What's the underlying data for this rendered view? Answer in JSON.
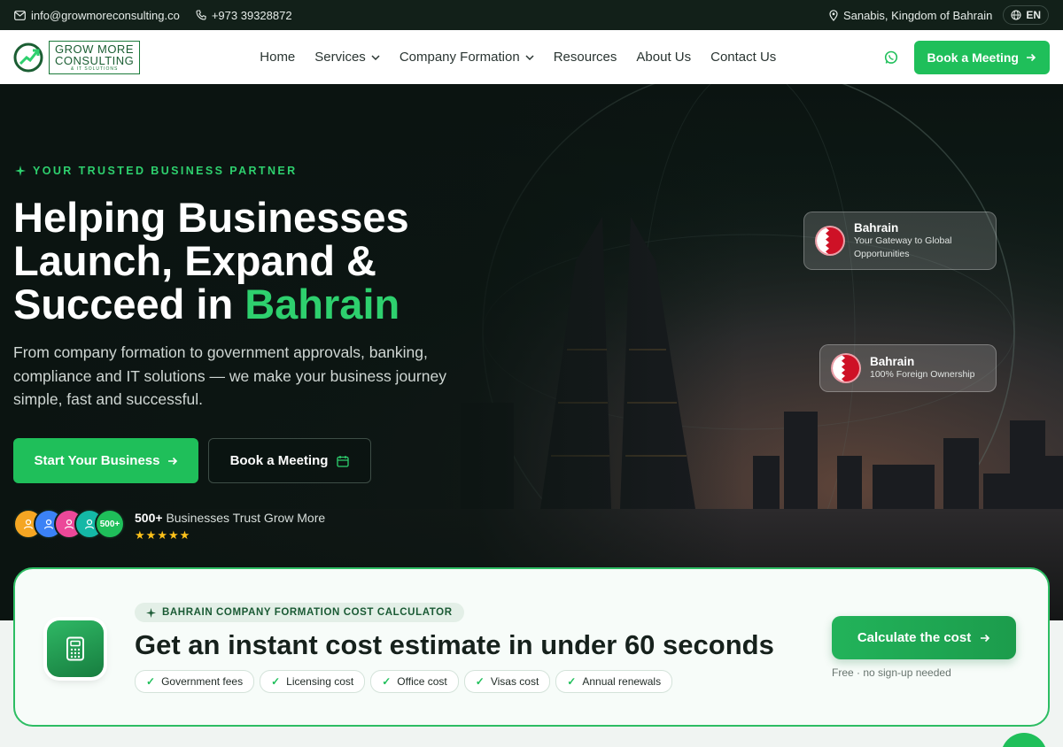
{
  "topbar": {
    "email": "info@growmoreconsulting.co",
    "phone": "+973 39328872",
    "location": "Sanabis, Kingdom of Bahrain",
    "language": "EN"
  },
  "brand": {
    "name_line1": "GROW MORE",
    "name_line2": "CONSULTING",
    "tagline": "& IT SOLUTIONS"
  },
  "nav": {
    "items": [
      {
        "label": "Home",
        "dropdown": false
      },
      {
        "label": "Services",
        "dropdown": true
      },
      {
        "label": "Company Formation",
        "dropdown": true
      },
      {
        "label": "Resources",
        "dropdown": false
      },
      {
        "label": "About Us",
        "dropdown": false
      },
      {
        "label": "Contact Us",
        "dropdown": false
      }
    ],
    "cta_label": "Book a Meeting"
  },
  "hero": {
    "eyebrow": "YOUR TRUSTED BUSINESS PARTNER",
    "headline_line1": "Helping Businesses",
    "headline_line2": "Launch, Expand &",
    "headline_line3_prefix": "Succeed in ",
    "headline_accent": "Bahrain",
    "subtitle": "From company formation to government approvals, banking, compliance and IT solutions — we make your business journey simple, fast and successful.",
    "primary_button": "Start Your Business",
    "secondary_button": "Book a Meeting",
    "trust_count": "500+",
    "trust_text": "Businesses Trust Grow More",
    "avatar_badge": "500+",
    "rating_stars": 5
  },
  "badges": [
    {
      "title": "Bahrain",
      "subtitle": "Your Gateway to Global Opportunities"
    },
    {
      "title": "Bahrain",
      "subtitle": "100% Foreign Ownership"
    }
  ],
  "calculator": {
    "tag": "BAHRAIN COMPANY FORMATION COST CALCULATOR",
    "title": "Get an instant cost estimate in under 60 seconds",
    "chips": [
      "Government fees",
      "Licensing cost",
      "Office cost",
      "Visas cost",
      "Annual renewals"
    ],
    "button": "Calculate the cost",
    "note": "Free · no sign-up needed"
  },
  "colors": {
    "accent": "#1fbf5a",
    "accent_text": "#2ed06e",
    "topbar": "#122019",
    "star": "#ffc21a",
    "flag_red": "#ce1126"
  },
  "icons": [
    "mail-icon",
    "phone-icon",
    "location-pin-icon",
    "globe-icon",
    "chevron-down-icon",
    "whatsapp-icon",
    "arrow-right-icon",
    "calendar-icon",
    "sparkle-icon",
    "calculator-icon",
    "check-icon",
    "star-icon"
  ]
}
